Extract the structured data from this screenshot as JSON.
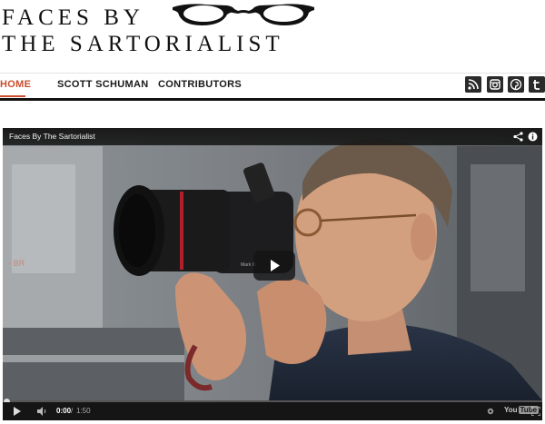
{
  "site": {
    "logo_line1": "FACES BY",
    "logo_line2": "THE SARTORIALIST",
    "logo_icon": "glasses-icon"
  },
  "nav": {
    "items": [
      {
        "label": "HOME",
        "active": true
      },
      {
        "label": "SCOTT SCHUMAN",
        "active": false
      },
      {
        "label": "CONTRIBUTORS",
        "active": false
      }
    ],
    "active_color": "#c94d2e"
  },
  "social": [
    {
      "icon": "rss-icon"
    },
    {
      "icon": "instagram-icon"
    },
    {
      "icon": "pinterest-icon"
    },
    {
      "icon": "twitter-icon"
    }
  ],
  "video": {
    "title": "Faces By The Sartorialist",
    "time_current": "0:00",
    "time_separator": "/",
    "time_total": "1:50",
    "progress": 0,
    "brand_you": "You",
    "brand_tube": "Tube",
    "progress_color": "#cc1a1a"
  }
}
